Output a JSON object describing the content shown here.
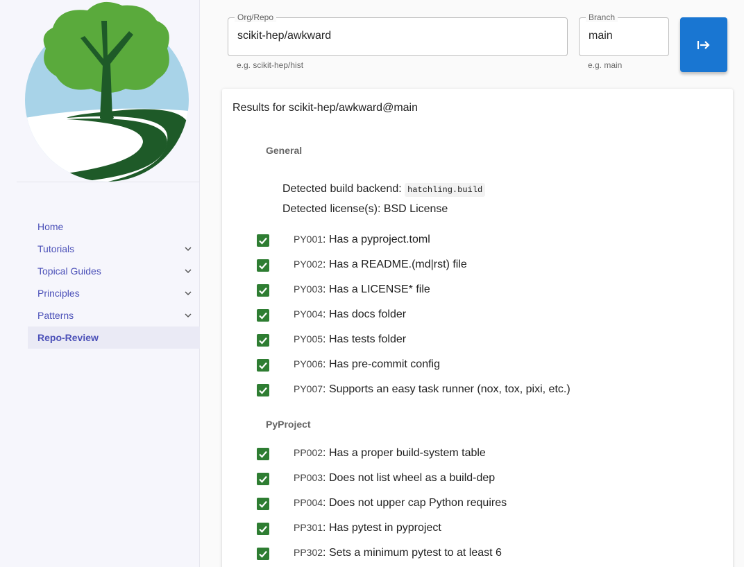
{
  "colors": {
    "accent": "#1976d2",
    "nav_link": "#4b50b8",
    "check": "#2e7d32",
    "logo_sky": "#a8d3e8",
    "logo_leaves": "#5aaa3c",
    "logo_trunk": "#1e5a28"
  },
  "sidebar": {
    "logo_icon": "tree-river-logo",
    "items": [
      {
        "label": "Home",
        "expandable": false,
        "active": false
      },
      {
        "label": "Tutorials",
        "expandable": true,
        "active": false
      },
      {
        "label": "Topical Guides",
        "expandable": true,
        "active": false
      },
      {
        "label": "Principles",
        "expandable": true,
        "active": false
      },
      {
        "label": "Patterns",
        "expandable": true,
        "active": false
      },
      {
        "label": "Repo-Review",
        "expandable": false,
        "active": true
      }
    ]
  },
  "form": {
    "repo_label": "Org/Repo",
    "repo_value": "scikit-hep/awkward",
    "repo_help": "e.g. scikit-hep/hist",
    "branch_label": "Branch",
    "branch_value": "main",
    "branch_help": "e.g. main",
    "submit_icon": "arrow-right-to-bar-icon"
  },
  "results": {
    "title": "Results for scikit-hep/awkward@main",
    "sections": [
      {
        "header": "General",
        "backend_label": "Detected build backend:",
        "backend_value": "hatchling.build",
        "license_text": "Detected license(s): BSD License",
        "checks": [
          {
            "code": "PY001",
            "text": "Has a pyproject.toml",
            "passed": true
          },
          {
            "code": "PY002",
            "text": "Has a README.(md|rst) file",
            "passed": true
          },
          {
            "code": "PY003",
            "text": "Has a LICENSE* file",
            "passed": true
          },
          {
            "code": "PY004",
            "text": "Has docs folder",
            "passed": true
          },
          {
            "code": "PY005",
            "text": "Has tests folder",
            "passed": true
          },
          {
            "code": "PY006",
            "text": "Has pre-commit config",
            "passed": true
          },
          {
            "code": "PY007",
            "text": "Supports an easy task runner (nox, tox, pixi, etc.)",
            "passed": true
          }
        ]
      },
      {
        "header": "PyProject",
        "checks": [
          {
            "code": "PP002",
            "text": "Has a proper build-system table",
            "passed": true
          },
          {
            "code": "PP003",
            "text": "Does not list wheel as a build-dep",
            "passed": true
          },
          {
            "code": "PP004",
            "text": "Does not upper cap Python requires",
            "passed": true
          },
          {
            "code": "PP301",
            "text": "Has pytest in pyproject",
            "passed": true
          },
          {
            "code": "PP302",
            "text": "Sets a minimum pytest to at least 6",
            "passed": true
          }
        ]
      }
    ]
  }
}
